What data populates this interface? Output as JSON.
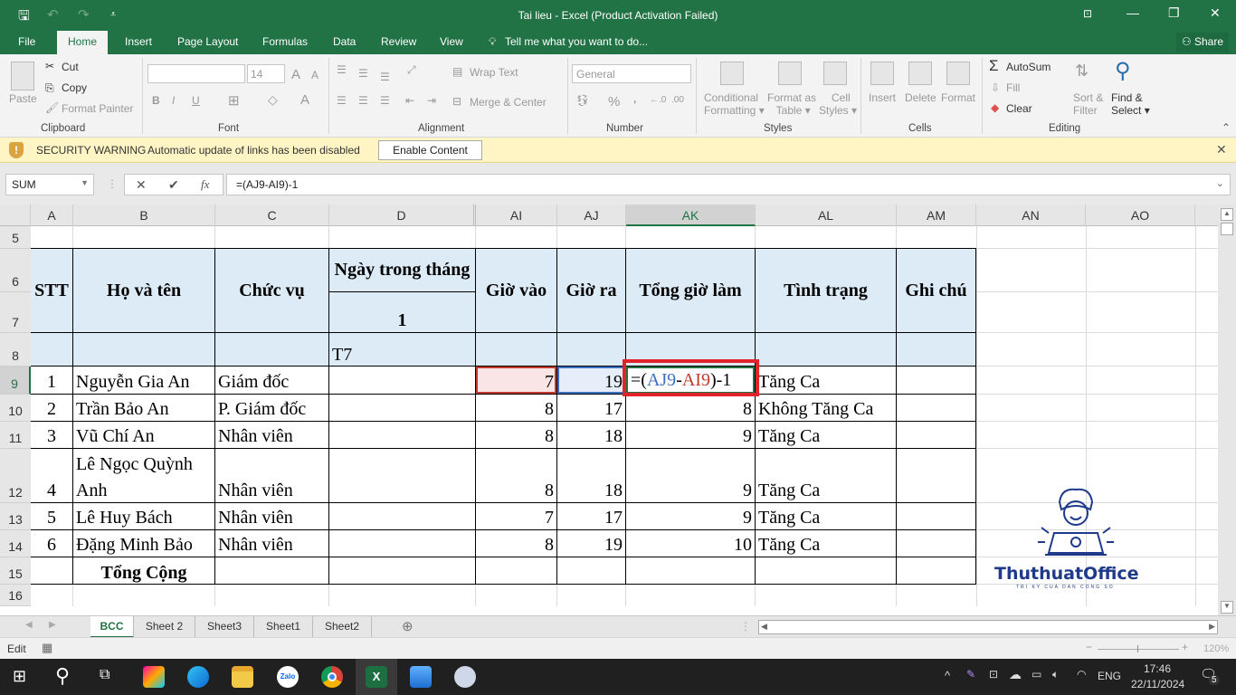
{
  "window": {
    "title": "Tai lieu - Excel (Product Activation Failed)",
    "quick_access": {
      "save": "save-icon",
      "undo": "undo-icon",
      "redo": "redo-icon",
      "customize": "customize-icon"
    },
    "controls": {
      "ribbon_display": "ribbon-display-icon",
      "minimize": "—",
      "restore": "❐",
      "close": "✕"
    }
  },
  "menu_tabs": [
    "File",
    "Home",
    "Insert",
    "Page Layout",
    "Formulas",
    "Data",
    "Review",
    "View"
  ],
  "active_tab": "Home",
  "tell_me": "Tell me what you want to do...",
  "share_label": "Share",
  "ribbon": {
    "clipboard": {
      "paste": "Paste",
      "cut": "Cut",
      "copy": "Copy",
      "format_painter": "Format Painter",
      "label": "Clipboard"
    },
    "font": {
      "font_name": "",
      "font_size": "14",
      "bold": "B",
      "italic": "I",
      "underline": "U",
      "grow": "A",
      "shrink": "A",
      "font_color": "A",
      "label": "Font"
    },
    "alignment": {
      "wrap_text": "Wrap Text",
      "merge_center": "Merge & Center",
      "label": "Alignment"
    },
    "number": {
      "format": "General",
      "percent": "%",
      "comma": ",",
      "label": "Number"
    },
    "styles": {
      "conditional": [
        "Conditional",
        "Formatting"
      ],
      "format_table": [
        "Format as",
        "Table"
      ],
      "cell_styles": [
        "Cell",
        "Styles"
      ],
      "label": "Styles"
    },
    "cells": {
      "insert": "Insert",
      "delete": "Delete",
      "format": "Format",
      "label": "Cells"
    },
    "editing": {
      "autosum": "AutoSum",
      "fill": "Fill",
      "clear": "Clear",
      "sort_filter": [
        "Sort &",
        "Filter"
      ],
      "find_select": [
        "Find &",
        "Select"
      ],
      "label": "Editing"
    }
  },
  "security_warning": {
    "title": "SECURITY WARNING",
    "message": "Automatic update of links has been disabled",
    "button": "Enable Content"
  },
  "formula_bar": {
    "name_box": "SUM",
    "cancel": "✕",
    "enter": "✔",
    "fx": "fx",
    "formula": "=(AJ9-AI9)-1"
  },
  "columns": [
    "A",
    "B",
    "C",
    "D",
    "AI",
    "AJ",
    "AK",
    "AL",
    "AM",
    "AN",
    "AO"
  ],
  "selected_column": "AK",
  "rows": [
    "5",
    "6",
    "7",
    "8",
    "9",
    "10",
    "11",
    "12",
    "13",
    "14",
    "15",
    "16"
  ],
  "selected_row": "9",
  "table": {
    "headers": {
      "stt": "STT",
      "name": "Họ và tên",
      "position": "Chức vụ",
      "days": "Ngày trong tháng",
      "day_num": "1",
      "day_label": "T7",
      "in": "Giờ vào",
      "out": "Giờ ra",
      "total": "Tổng giờ làm",
      "status": "Tình trạng",
      "note": "Ghi chú"
    },
    "editing_cell": {
      "prefix": "=(",
      "ref1": "AJ9",
      "minus": "-",
      "ref2": "AI9",
      "suffix": ")-1"
    },
    "rows": [
      {
        "stt": "1",
        "name": "Nguyễn Gia An",
        "position": "Giám đốc",
        "in": "7",
        "out": "19",
        "total": "",
        "status": "Tăng Ca"
      },
      {
        "stt": "2",
        "name": "Trần Bảo An",
        "position": "P. Giám đốc",
        "in": "8",
        "out": "17",
        "total": "8",
        "status": "Không Tăng Ca"
      },
      {
        "stt": "3",
        "name": "Vũ Chí An",
        "position": "Nhân viên",
        "in": "8",
        "out": "18",
        "total": "9",
        "status": "Tăng Ca"
      },
      {
        "stt": "4",
        "name_line1": "Lê Ngọc Quỳnh",
        "name": "Anh",
        "position": "Nhân viên",
        "in": "8",
        "out": "18",
        "total": "9",
        "status": "Tăng Ca"
      },
      {
        "stt": "5",
        "name": "Lê Huy Bách",
        "position": "Nhân viên",
        "in": "7",
        "out": "17",
        "total": "9",
        "status": "Tăng Ca"
      },
      {
        "stt": "6",
        "name": "Đặng Minh Bảo",
        "position": "Nhân viên",
        "in": "8",
        "out": "19",
        "total": "10",
        "status": "Tăng Ca"
      }
    ],
    "total_label": "Tổng Cộng"
  },
  "sheet_tabs": [
    "BCC",
    "Sheet 2",
    "Sheet3",
    "Sheet1",
    "Sheet2"
  ],
  "active_sheet": "BCC",
  "status_bar": {
    "mode": "Edit",
    "zoom": "120%"
  },
  "logo": {
    "name": "ThuthuatOffice",
    "tagline": "TRI KY CUA DAN CONG SO"
  },
  "taskbar": {
    "apps": [
      "windows-start",
      "search",
      "task-view",
      "copilot",
      "edge",
      "file-explorer",
      "zalo",
      "chrome",
      "excel",
      "photos",
      "paint"
    ],
    "zalo_label": "Zalo",
    "language": "ENG",
    "time": "17:46",
    "date": "22/11/2024",
    "notifications": "5"
  }
}
